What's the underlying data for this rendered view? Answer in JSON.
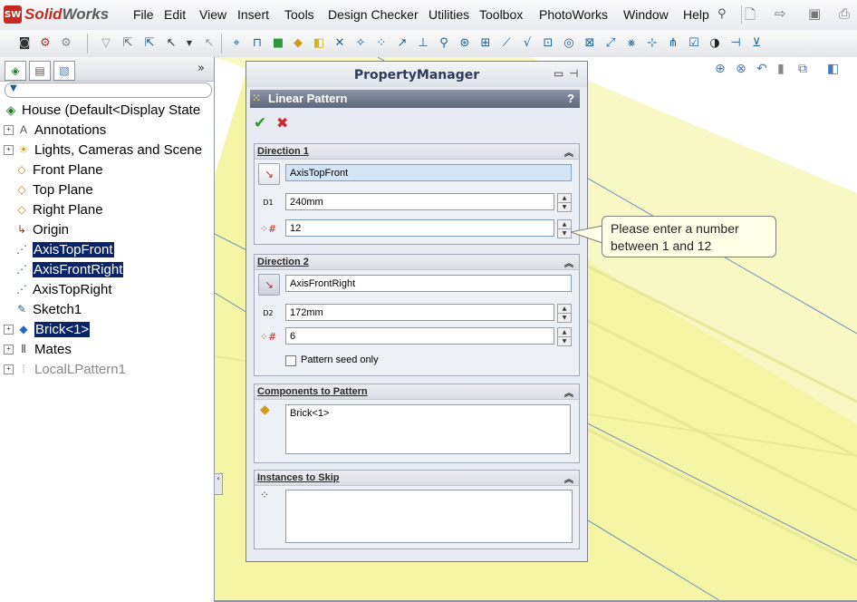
{
  "app": {
    "brand_prefix": "Solid",
    "brand_suffix": "Works",
    "logo_badge": "SW"
  },
  "menu": [
    "File",
    "Edit",
    "View",
    "Insert",
    "Tools",
    "Design Checker",
    "Utilities",
    "Toolbox",
    "PhotoWorks",
    "Window",
    "Help"
  ],
  "tree": {
    "root": "House  (Default<Display State",
    "items": [
      {
        "label": "Annotations",
        "icon": "annotations-icon",
        "sym": "A",
        "expand": true,
        "selected": false,
        "dim": false
      },
      {
        "label": "Lights, Cameras and Scene",
        "icon": "lights-icon",
        "sym": "☀",
        "expand": true,
        "selected": false,
        "dim": false
      },
      {
        "label": "Front Plane",
        "icon": "plane-icon",
        "sym": "◇",
        "expand": false,
        "selected": false,
        "dim": false
      },
      {
        "label": "Top Plane",
        "icon": "plane-icon",
        "sym": "◇",
        "expand": false,
        "selected": false,
        "dim": false
      },
      {
        "label": "Right Plane",
        "icon": "plane-icon",
        "sym": "◇",
        "expand": false,
        "selected": false,
        "dim": false
      },
      {
        "label": "Origin",
        "icon": "origin-icon",
        "sym": "↳",
        "expand": false,
        "selected": false,
        "dim": false
      },
      {
        "label": "AxisTopFront",
        "icon": "axis-icon",
        "sym": "⋰",
        "expand": false,
        "selected": true,
        "dim": false
      },
      {
        "label": "AxisFrontRight",
        "icon": "axis-icon",
        "sym": "⋰",
        "expand": false,
        "selected": true,
        "dim": false
      },
      {
        "label": "AxisTopRight",
        "icon": "axis-icon",
        "sym": "⋰",
        "expand": false,
        "selected": false,
        "dim": false
      },
      {
        "label": "Sketch1",
        "icon": "sketch-icon",
        "sym": "✎",
        "expand": false,
        "selected": false,
        "dim": false
      },
      {
        "label": "Brick<1>",
        "icon": "part-icon",
        "sym": "◆",
        "expand": true,
        "selected": true,
        "dim": false
      },
      {
        "label": "Mates",
        "icon": "mates-icon",
        "sym": "⫴",
        "expand": true,
        "selected": false,
        "dim": false
      },
      {
        "label": "LocalLPattern1",
        "icon": "pattern-icon",
        "sym": "⁞",
        "expand": true,
        "selected": false,
        "dim": true
      }
    ]
  },
  "pm": {
    "title": "PropertyManager",
    "feature": "Linear Pattern",
    "help": "?",
    "ok": "✔",
    "cancel": "✖",
    "dir1": {
      "header": "Direction 1",
      "axis": "AxisTopFront",
      "spacing": "240mm",
      "instances": "12",
      "spacing_tag": "D1"
    },
    "dir2": {
      "header": "Direction 2",
      "axis": "AxisFrontRight",
      "spacing": "172mm",
      "instances": "6",
      "spacing_tag": "D2",
      "seed_only": "Pattern seed only"
    },
    "components": {
      "header": "Components to Pattern",
      "items": "Brick<1>"
    },
    "skip": {
      "header": "Instances to Skip"
    }
  },
  "tooltip": {
    "line1": "Please enter a number",
    "line2": "between 1 and 12"
  },
  "colors": {
    "selection": "#0a246a",
    "feature_bar": "#6b7489",
    "graphics_fill": "#f5f5a6"
  }
}
